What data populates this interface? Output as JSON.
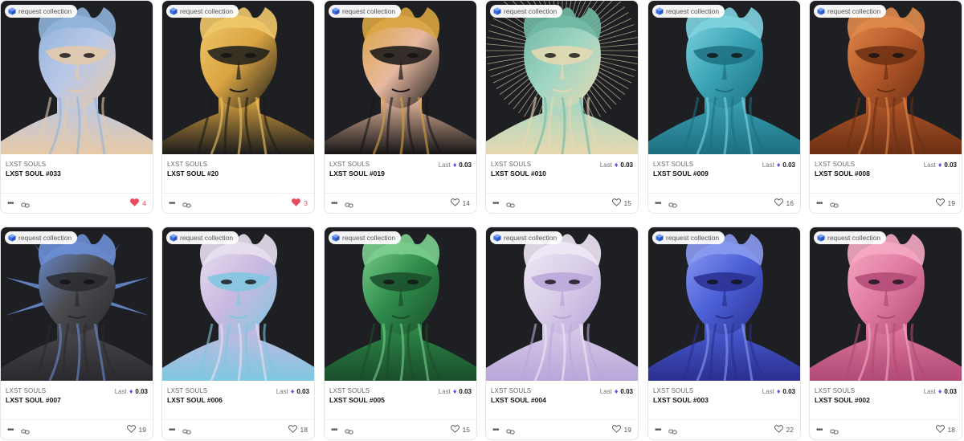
{
  "badge_label": "request collection",
  "last_label": "Last",
  "eth_symbol": "♦",
  "colors": {
    "background_art": "#1e1f22",
    "liked_heart": "#e84a5f",
    "eth_accent": "#6f4ef2"
  },
  "cards": [
    {
      "collection": "LXST SOULS",
      "title": "LXST SOUL #033",
      "last_price": null,
      "likes": "4",
      "liked": true,
      "palette": [
        "#b9c8e8",
        "#e6c9a8",
        "#8fb3d9"
      ]
    },
    {
      "collection": "LXST SOULS",
      "title": "LXST SOUL #20",
      "last_price": null,
      "likes": "3",
      "liked": true,
      "palette": [
        "#d9a441",
        "#1b1b1b",
        "#f0c86a"
      ]
    },
    {
      "collection": "LXST SOULS",
      "title": "LXST SOUL #019",
      "last_price": "0.03",
      "likes": "14",
      "liked": false,
      "palette": [
        "#e8b9a0",
        "#151515",
        "#d9a441"
      ]
    },
    {
      "collection": "LXST SOULS",
      "title": "LXST SOUL #010",
      "last_price": "0.03",
      "likes": "15",
      "liked": false,
      "palette": [
        "#9fd6c4",
        "#e8d9b0",
        "#6fb7a3"
      ]
    },
    {
      "collection": "LXST SOULS",
      "title": "LXST SOUL #009",
      "last_price": "0.03",
      "likes": "16",
      "liked": false,
      "palette": [
        "#3aa3b5",
        "#1d6f80",
        "#7fd3e0"
      ]
    },
    {
      "collection": "LXST SOULS",
      "title": "LXST SOUL #008",
      "last_price": "0.03",
      "likes": "19",
      "liked": false,
      "palette": [
        "#b4582a",
        "#6b2f13",
        "#e08a4c"
      ]
    },
    {
      "collection": "LXST SOULS",
      "title": "LXST SOUL #007",
      "last_price": "0.03",
      "likes": "19",
      "liked": false,
      "palette": [
        "#4b4b50",
        "#2a2a2e",
        "#6b8fd6"
      ]
    },
    {
      "collection": "LXST SOULS",
      "title": "LXST SOUL #006",
      "last_price": "0.03",
      "likes": "18",
      "liked": false,
      "palette": [
        "#c9b8e0",
        "#7fc7e0",
        "#e8e0f0"
      ]
    },
    {
      "collection": "LXST SOULS",
      "title": "LXST SOUL #005",
      "last_price": "0.03",
      "likes": "15",
      "liked": false,
      "palette": [
        "#2e8b4a",
        "#1a4d2a",
        "#7ccf8f"
      ]
    },
    {
      "collection": "LXST SOULS",
      "title": "LXST SOUL #004",
      "last_price": "0.03",
      "likes": "19",
      "liked": false,
      "palette": [
        "#d8cde8",
        "#b9a6d9",
        "#f0e8f5"
      ]
    },
    {
      "collection": "LXST SOULS",
      "title": "LXST SOUL #003",
      "last_price": "0.03",
      "likes": "22",
      "liked": false,
      "palette": [
        "#4b5fd6",
        "#2a2f8f",
        "#8a9bf0"
      ]
    },
    {
      "collection": "LXST SOULS",
      "title": "LXST SOUL #002",
      "last_price": "0.03",
      "likes": "18",
      "liked": false,
      "palette": [
        "#e07aa0",
        "#b04a75",
        "#f5a9c4"
      ]
    }
  ]
}
